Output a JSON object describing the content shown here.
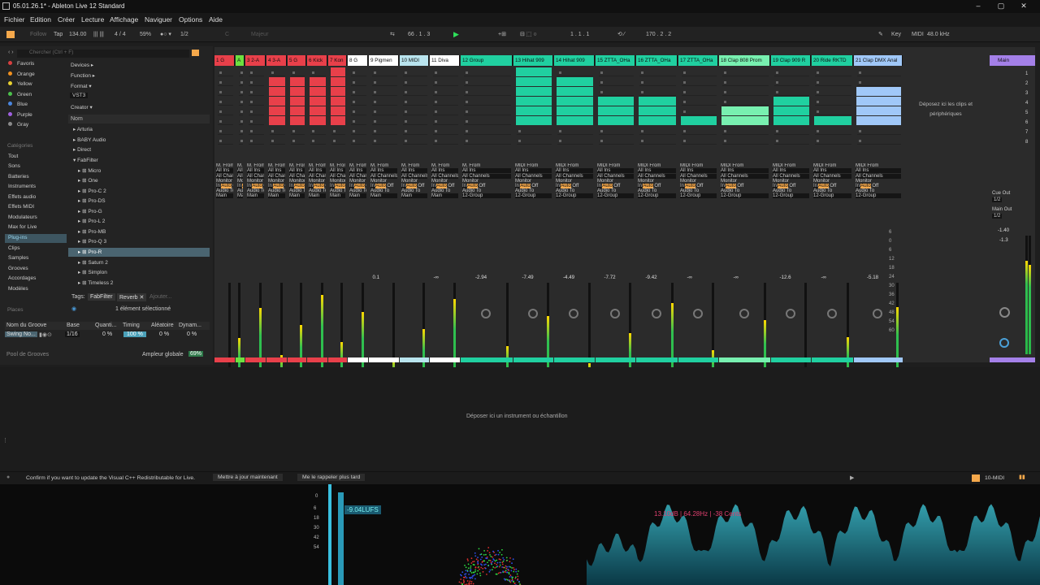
{
  "title": "05.01.26.1* - Ableton Live 12 Standard",
  "menu": [
    "Fichier",
    "Edition",
    "Créer",
    "Lecture",
    "Affichage",
    "Naviguer",
    "Options",
    "Aide"
  ],
  "transport": {
    "follow": "Follow",
    "tap": "Tap",
    "tempo": "134.00",
    "signature": "4 / 4",
    "metronome_percent": "59%",
    "quant": "1/2",
    "key": "C",
    "scale": "Majeur",
    "position": "66 . 1 . 3",
    "loop_start": "1 . 1 . 1",
    "loop_len": "170 . 2 . 2",
    "key_label": "Key",
    "midi_label": "MIDI",
    "sample_rate": "48.0 kHz"
  },
  "browser": {
    "search_placeholder": "Chercher (Ctrl + F)",
    "collections": [
      {
        "label": "Favoris",
        "color": "#d84040"
      },
      {
        "label": "Orange",
        "color": "#f0901e"
      },
      {
        "label": "Yellow",
        "color": "#e8d030"
      },
      {
        "label": "Green",
        "color": "#4bc04b"
      },
      {
        "label": "Blue",
        "color": "#4a86e0"
      },
      {
        "label": "Purple",
        "color": "#a060e0"
      },
      {
        "label": "Gray",
        "color": "#8a8a8a"
      }
    ],
    "categories_title": "Catégories",
    "categories": [
      "Tout",
      "Sons",
      "Batteries",
      "Instruments",
      "Effets audio",
      "Effets MIDI",
      "Modulateurs",
      "Max for Live",
      "Plug-ins",
      "Clips",
      "Samples",
      "Grooves",
      "Accordages",
      "Modèles"
    ],
    "places_title": "Places",
    "filters": [
      "Devices ▸",
      "Function ▸",
      "Format ▾",
      "VST3",
      "Creator ▾"
    ],
    "name_header": "Nom",
    "tree": [
      "Arturia",
      "BABY Audio",
      "Direct",
      "FabFilter",
      "Micro",
      "One",
      "Pro-C 2",
      "Pro-DS",
      "Pro-G",
      "Pro-L 2",
      "Pro-MB",
      "Pro-Q 3",
      "Pro-R",
      "Saturn 2",
      "Simplon",
      "Timeless 2"
    ],
    "tags_label": "Tags:",
    "tag_fabfilter": "FabFilter",
    "tag_reverb": "Reverb",
    "tag_add": "Ajouter...",
    "selection": "1 élément sélectionné",
    "groove": {
      "headers": [
        "Nom du Groove",
        "Base",
        "Quanti...",
        "Timing",
        "Aléatoire",
        "Dynam..."
      ],
      "row": [
        "Swing No...",
        "1/16",
        "0 %",
        "100 %",
        "0 %",
        "0 %"
      ],
      "pool": "Pool de Grooves",
      "amp_label": "Ampleur globale",
      "amp_value": "69%"
    }
  },
  "tracks": [
    {
      "name": "1 G",
      "color": "#e8404a",
      "num": "1",
      "vol": ""
    },
    {
      "name": "A",
      "color": "#6ee040",
      "num": "2",
      "vol": ""
    },
    {
      "name": "3 2-A",
      "color": "#e8404a",
      "num": "3",
      "vol": ""
    },
    {
      "name": "4 3-A",
      "color": "#e8404a",
      "num": "4",
      "vol": ""
    },
    {
      "name": "5 G",
      "color": "#e8404a",
      "num": "5",
      "vol": ""
    },
    {
      "name": "6 Kick",
      "color": "#e8404a",
      "num": "6",
      "vol": ""
    },
    {
      "name": "7 Kon",
      "color": "#e8404a",
      "num": "7",
      "vol": ""
    },
    {
      "name": "8 G",
      "color": "#ffffff",
      "num": "8",
      "vol": ""
    },
    {
      "name": "9 Pigmen",
      "color": "#ffffff",
      "num": "9",
      "vol": "0.1"
    },
    {
      "name": "10 MIDI",
      "color": "#b9e4ee",
      "num": "10",
      "vol": ""
    },
    {
      "name": "11 Diva",
      "color": "#ffffff",
      "num": "11",
      "vol": "-∞"
    },
    {
      "name": "12 Group",
      "color": "#20d0a0",
      "num": "12",
      "vol": "-2.94"
    },
    {
      "name": "13 Hihat 909",
      "color": "#20d0a0",
      "num": "13",
      "vol": "-7.49"
    },
    {
      "name": "14 Hihat 909",
      "color": "#20d0a0",
      "num": "14",
      "vol": "-4.49"
    },
    {
      "name": "15 ZTTA_OHa",
      "color": "#20d0a0",
      "num": "15",
      "vol": "-7.72"
    },
    {
      "name": "16 ZTTA_OHa",
      "color": "#20d0a0",
      "num": "16",
      "vol": "-9.42"
    },
    {
      "name": "17 ZTTA_OHa",
      "color": "#20d0a0",
      "num": "17",
      "vol": "-∞"
    },
    {
      "name": "18 Clap 808 Prom",
      "color": "#78f0b0",
      "num": "18",
      "vol": "-∞"
    },
    {
      "name": "19 Clap 909 R",
      "color": "#20d0a0",
      "num": "19",
      "vol": "-12.6"
    },
    {
      "name": "20 Ride RKTD",
      "color": "#20d0a0",
      "num": "20",
      "vol": "-∞"
    },
    {
      "name": "21 Clap DMX Anal",
      "color": "#a0c8f8",
      "num": "21",
      "vol": "-5.18"
    }
  ],
  "io": {
    "midi_from": "MIDI From",
    "all_ins": "All Ins",
    "all_channels": "All Channels",
    "monitor": "Monitor",
    "in": "In",
    "auto": "Auto",
    "off": "Off",
    "audio_to": "Audio To",
    "group12": "12-Group",
    "main": "Main",
    "a_to": "A. To",
    "no_output": "No Output",
    "post": "Post",
    "midi_from_short": "M. From"
  },
  "drop_clips": "Déposez ici les clips et périphériques",
  "master": {
    "name": "Main",
    "cue_out": "Cue Out",
    "cue_val": "1/2",
    "main_out": "Main Out",
    "main_val": "1/2",
    "vol": "-1.40",
    "pan": "-1.3"
  },
  "scene_numbers": [
    "1",
    "2",
    "3",
    "4",
    "5",
    "6",
    "7",
    "8"
  ],
  "db_scale": [
    "6",
    "0",
    "6",
    "12",
    "18",
    "24",
    "30",
    "36",
    "42",
    "48",
    "54",
    "60"
  ],
  "drop_instrument": "Déposer ici un instrument ou échantillon",
  "status": {
    "message": "Confirm if you want to update the Visual C++ Redistributable for Live.",
    "update_btn": "Mettre à jour maintenant",
    "later_btn": "Me le rappeler plus tard",
    "track_name": "10-MIDI"
  },
  "viz": {
    "lufs": "-9.04LUFS",
    "db_labels": [
      "0",
      "6",
      "12",
      "18",
      "24",
      "30",
      "36",
      "42",
      "48",
      "54",
      "60"
    ],
    "spectrum_label": "13.10dB | 64.28Hz | -38 Cents"
  }
}
